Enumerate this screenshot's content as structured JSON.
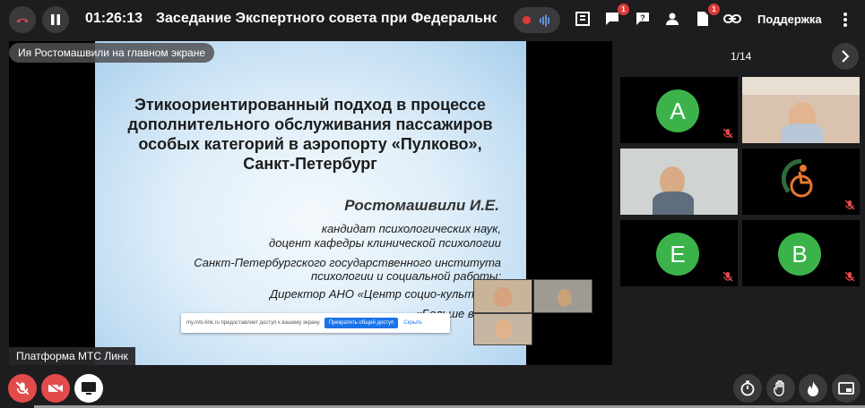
{
  "header": {
    "timer": "01:26:13",
    "title": "Заседание Экспертного совета при Федеральном р",
    "support_label": "Поддержка",
    "badges": {
      "chat": "1",
      "files": "1"
    }
  },
  "stage": {
    "presenter_label": "Ия Ростомашвили на главном экране",
    "platform_label": "Платформа МТС Линк",
    "slide": {
      "title_lines": [
        "Этикоориентированный подход в процессе",
        "дополнительного обслуживания пассажиров",
        "особых категорий в аэропорту «Пулково»,",
        "Санкт-Петербург"
      ],
      "author": "Ростомашвили И.Е.",
      "lines": [
        "кандидат психологических наук,",
        "доцент кафедры клинической психологии",
        "Санкт-Петербургского государственного института",
        "психологии и социальной работы;",
        "Директор АНО «Центр социо-культурных прак",
        "«Больше возможнос"
      ]
    },
    "share_bar": {
      "text": "my.mts-link.ru предоставляет доступ к вашему экрану.",
      "stop_button": "Прекратить общий доступ",
      "hide_link": "Скрыть"
    }
  },
  "participants": {
    "pager": "1/14",
    "tiles": [
      {
        "type": "avatar",
        "letter": "А",
        "muted": true
      },
      {
        "type": "video",
        "muted": false
      },
      {
        "type": "video",
        "muted": false
      },
      {
        "type": "logo",
        "muted": true
      },
      {
        "type": "avatar",
        "letter": "Е",
        "muted": true
      },
      {
        "type": "avatar",
        "letter": "В",
        "muted": true
      }
    ]
  },
  "colors": {
    "accent_red": "#e34a4a",
    "avatar_green": "#3bb34a",
    "background": "#1d1d1f"
  },
  "icons": [
    "end-call-icon",
    "pause-icon",
    "recording-dot-icon",
    "audio-wave-icon",
    "poll-icon",
    "chat-icon",
    "question-icon",
    "people-icon",
    "file-icon",
    "link-icon",
    "kebab-icon",
    "chevron-right-icon",
    "mic-off-icon",
    "camera-off-icon",
    "screen-share-icon",
    "timer-icon",
    "raise-hand-icon",
    "reaction-fire-icon",
    "layout-icon"
  ]
}
